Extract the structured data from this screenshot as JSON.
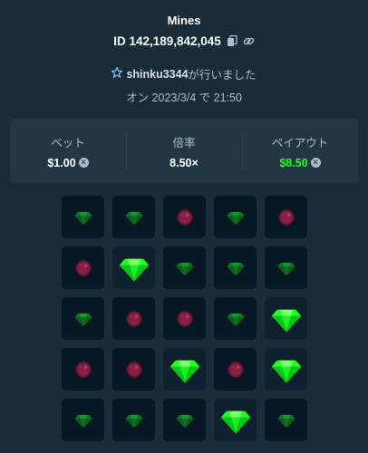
{
  "header": {
    "title": "Mines",
    "id_text": "ID 142,189,842,045",
    "username": "shinku3344",
    "played_suffix": "が行いました",
    "date_text": "オン 2023/3/4 で 21:50"
  },
  "stats": {
    "bet_label": "ベット",
    "bet_value": "$1.00",
    "multiplier_label": "倍率",
    "multiplier_value": "8.50×",
    "payout_label": "ペイアウト",
    "payout_value": "$8.50"
  },
  "colors": {
    "background": "#1a2c38",
    "panel": "#213743",
    "tile": "#071824",
    "gem": "#1fff20",
    "gem_dim": "#0a6a1c",
    "mine": "#7a1a38"
  },
  "board": {
    "rows": [
      [
        "gem-dim",
        "gem-dim",
        "mine-dim",
        "gem-dim",
        "mine-dim"
      ],
      [
        "mine-dim",
        "gem",
        "gem-dim",
        "gem-dim",
        "gem-dim"
      ],
      [
        "gem-dim",
        "mine-dim",
        "mine-dim",
        "gem-dim",
        "gem"
      ],
      [
        "mine-dim",
        "mine-dim",
        "gem",
        "mine-dim",
        "gem"
      ],
      [
        "gem-dim",
        "gem-dim",
        "gem-dim",
        "gem",
        "gem-dim"
      ]
    ]
  }
}
